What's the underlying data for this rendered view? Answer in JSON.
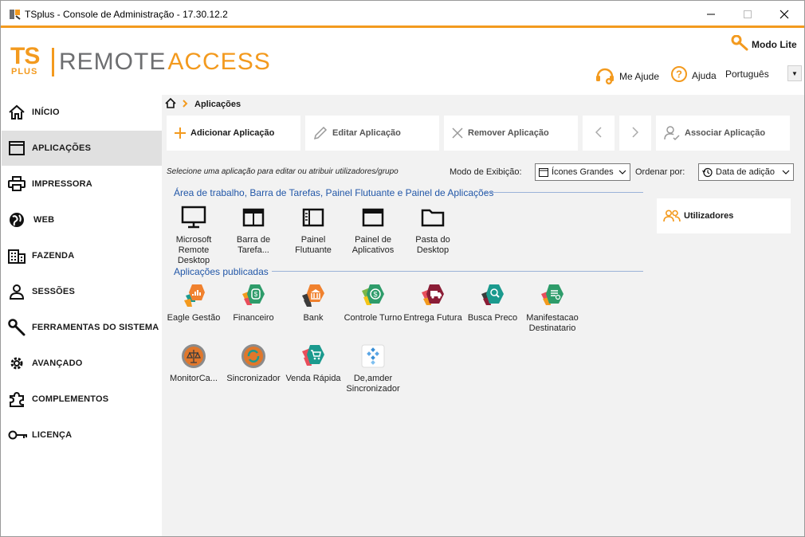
{
  "window": {
    "title": "TSplus - Console de Administração - 17.30.12.2"
  },
  "header": {
    "logo": {
      "ts": "TS",
      "plus": "PLUS",
      "remote": "REMOTE",
      "access": "ACCESS"
    },
    "modo_lite": "Modo Lite",
    "me_ajude": "Me Ajude",
    "ajuda": "Ajuda",
    "language": "Português"
  },
  "sidebar": {
    "items": [
      {
        "label": "INÍCIO",
        "icon": "home-icon"
      },
      {
        "label": "APLICAÇÕES",
        "icon": "window-icon"
      },
      {
        "label": "IMPRESSORA",
        "icon": "printer-icon"
      },
      {
        "label": "WEB",
        "icon": "globe-icon"
      },
      {
        "label": "FAZENDA",
        "icon": "building-icon"
      },
      {
        "label": "SESSÕES",
        "icon": "user-icon"
      },
      {
        "label": "FERRAMENTAS DO SISTEMA",
        "icon": "wrench-icon"
      },
      {
        "label": "AVANÇADO",
        "icon": "gear-icon"
      },
      {
        "label": "COMPLEMENTOS",
        "icon": "puzzle-icon"
      },
      {
        "label": "LICENÇA",
        "icon": "key-icon"
      }
    ]
  },
  "breadcrumb": {
    "current": "Aplicações"
  },
  "toolbar": {
    "add": "Adicionar Aplicação",
    "edit": "Editar Aplicação",
    "remove": "Remover Aplicação",
    "assign": "Associar Aplicação"
  },
  "controls": {
    "hint": "Selecione uma aplicação para editar ou atribuir utilizadores/grupo",
    "view_mode_label": "Modo de Exibição:",
    "view_mode_value": "Ícones Grandes",
    "sort_label": "Ordenar por:",
    "sort_value": "Data de adição"
  },
  "groups": {
    "desktop_title": "Área de trabalho, Barra de Tarefas, Painel Flutuante e Painel de Aplicações",
    "desktop_items": [
      {
        "label": "Microsoft Remote Desktop",
        "icon": "monitor-icon"
      },
      {
        "label": "Barra de Tarefa...",
        "icon": "taskbar-icon"
      },
      {
        "label": "Painel Flutuante",
        "icon": "floating-panel-icon"
      },
      {
        "label": "Painel de Aplicativos",
        "icon": "app-panel-icon"
      },
      {
        "label": "Pasta do Desktop",
        "icon": "folder-icon"
      }
    ],
    "published_title": "Aplicações publicadas",
    "published_items": [
      {
        "label": "Eagle Gestão",
        "icon": "eagle-gestao-icon",
        "color": "#f0812e"
      },
      {
        "label": "Financeiro",
        "icon": "financeiro-icon",
        "color": "#2e9c6a"
      },
      {
        "label": "Bank",
        "icon": "bank-icon",
        "color": "#f0812e"
      },
      {
        "label": "Controle Turno",
        "icon": "controle-turno-icon",
        "color": "#2e9c6a"
      },
      {
        "label": "Entrega Futura",
        "icon": "entrega-futura-icon",
        "color": "#8b1d36"
      },
      {
        "label": "Busca Preco",
        "icon": "busca-preco-icon",
        "color": "#1b9a8e"
      },
      {
        "label": "Manifestacao Destinatario",
        "icon": "manifestacao-icon",
        "color": "#2e9c6a"
      },
      {
        "label": "MonitorCa...",
        "icon": "monitor-caixa-icon",
        "color": "#e0772b"
      },
      {
        "label": "Sincronizador",
        "icon": "sincronizador-icon",
        "color": "#e0772b"
      },
      {
        "label": "Venda Rápida",
        "icon": "venda-rapida-icon",
        "color": "#1b9a8e"
      },
      {
        "label": "De,amder Sincronizador",
        "icon": "demander-icon",
        "color": "#3a8fd6"
      }
    ]
  },
  "users_panel": {
    "label": "Utilizadores"
  }
}
